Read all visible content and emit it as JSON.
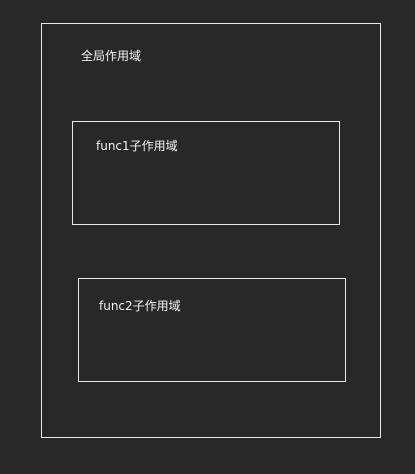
{
  "scopes": {
    "global": {
      "label": "全局作用域"
    },
    "func1": {
      "label": "func1子作用域"
    },
    "func2": {
      "label": "func2子作用域"
    }
  },
  "colors": {
    "background": "#282828",
    "border": "#e8e8e8",
    "text": "#f2f2f2"
  }
}
